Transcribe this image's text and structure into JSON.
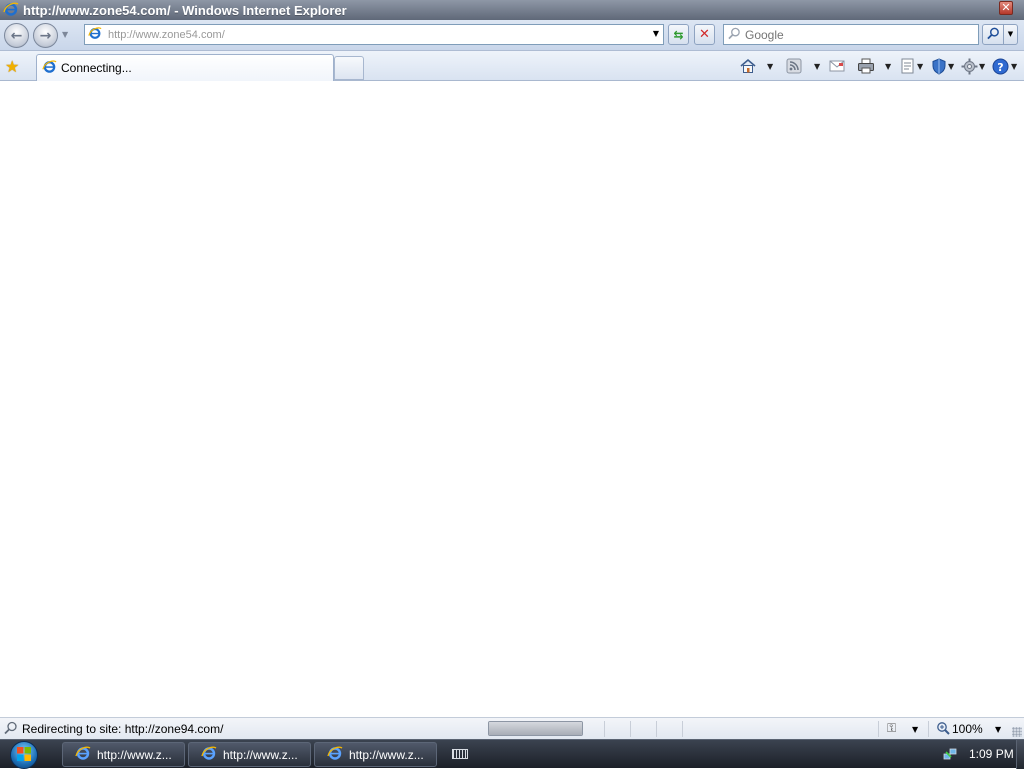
{
  "window": {
    "title": "http://www.zone54.com/ - Windows Internet Explorer",
    "close_glyph": "✕"
  },
  "navbar": {
    "back_glyph": "←",
    "forward_glyph": "→",
    "recent_drop_glyph": "▼",
    "address_value": "http://www.zone54.com/",
    "address_drop_glyph": "▼",
    "refresh_glyph": "⇆",
    "stop_glyph": "✕",
    "search_placeholder": "Google",
    "search_opts_glyph": "▼"
  },
  "tabs": {
    "favorites_glyph": "★",
    "active_tab_label": "Connecting...",
    "drop_glyph": "▼"
  },
  "statusbar": {
    "text": "Redirecting to site: http://zone94.com/",
    "zoom": "100%",
    "progress": 1.0,
    "drop_glyph": "▼",
    "zone_glyph": "⚿"
  },
  "taskbar": {
    "buttons": [
      {
        "label": "http://www.z..."
      },
      {
        "label": "http://www.z..."
      },
      {
        "label": "http://www.z..."
      }
    ],
    "clock": "1:09 PM"
  },
  "colors": {
    "ie_blue": "#1f6fcf",
    "ie_gold": "#f2b705",
    "stop_red": "#d12a2a",
    "refresh_green": "#2e9a2e"
  }
}
